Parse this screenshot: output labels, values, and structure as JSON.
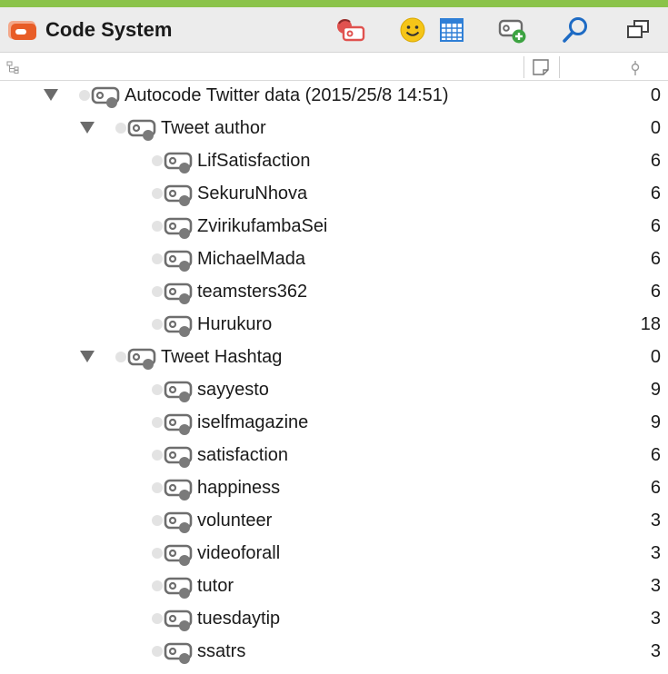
{
  "header": {
    "title": "Code System",
    "toolbar": [
      {
        "name": "activate-codes-icon",
        "color": "#e0524f"
      },
      {
        "name": "emoticode-icon",
        "color": "#f5c518"
      },
      {
        "name": "table-icon",
        "color": "#2f7fd6"
      },
      {
        "name": "new-code-icon",
        "color": "#3ca341"
      },
      {
        "name": "search-icon",
        "color": "#1e6bc4"
      },
      {
        "name": "undock-window-icon",
        "color": "#444444"
      }
    ]
  },
  "columns": {
    "tree_icon": "hierarchy-icon",
    "memo_icon": "memo-icon",
    "frequency_icon": "frequency-icon"
  },
  "tree": [
    {
      "label": "Autocode Twitter data (2015/25/8 14:51)",
      "count": "0",
      "level": 0,
      "expanded": true
    },
    {
      "label": "Tweet author",
      "count": "0",
      "level": 1,
      "expanded": true
    },
    {
      "label": "LifSatisfaction",
      "count": "6",
      "level": 2
    },
    {
      "label": "SekuruNhova",
      "count": "6",
      "level": 2
    },
    {
      "label": "ZvirikufambaSei",
      "count": "6",
      "level": 2
    },
    {
      "label": "MichaelMada",
      "count": "6",
      "level": 2
    },
    {
      "label": "teamsters362",
      "count": "6",
      "level": 2
    },
    {
      "label": "Hurukuro",
      "count": "18",
      "level": 2
    },
    {
      "label": "Tweet Hashtag",
      "count": "0",
      "level": 1,
      "expanded": true
    },
    {
      "label": "sayyesto",
      "count": "9",
      "level": 2
    },
    {
      "label": "iselfmagazine",
      "count": "9",
      "level": 2
    },
    {
      "label": "satisfaction",
      "count": "6",
      "level": 2
    },
    {
      "label": "happiness",
      "count": "6",
      "level": 2
    },
    {
      "label": "volunteer",
      "count": "3",
      "level": 2
    },
    {
      "label": "videoforall",
      "count": "3",
      "level": 2
    },
    {
      "label": "tutor",
      "count": "3",
      "level": 2
    },
    {
      "label": "tuesdaytip",
      "count": "3",
      "level": 2
    },
    {
      "label": "ssatrs",
      "count": "3",
      "level": 2
    }
  ]
}
